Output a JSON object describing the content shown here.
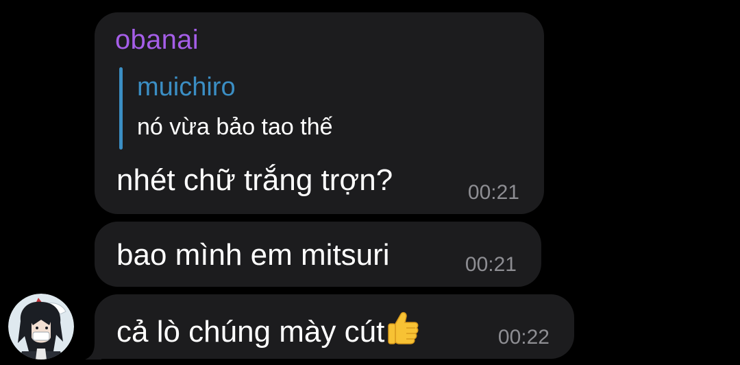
{
  "chat": {
    "messages": [
      {
        "sender": "obanai",
        "reply": {
          "name": "muichiro",
          "text": "nó vừa bảo tao thế"
        },
        "text": "nhét chữ trắng trợn?",
        "time": "00:21"
      },
      {
        "text": "bao mình em mitsuri",
        "time": "00:21"
      },
      {
        "text": "cả lò chúng mày cút",
        "emoji": "thumbs-up-icon",
        "time": "00:22"
      }
    ]
  },
  "colors": {
    "background": "#000000",
    "bubble": "#1c1c1e",
    "sender_name": "#a55ee8",
    "reply_accent": "#3b8ec4",
    "text": "#ffffff",
    "timestamp": "#8e8e93"
  }
}
